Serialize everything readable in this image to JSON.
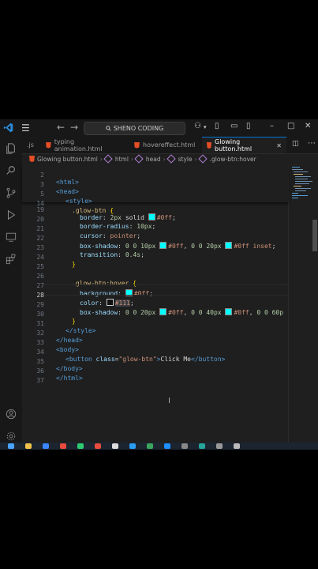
{
  "titlebar": {
    "search_text": "SHENO CODING",
    "menu_icon": "hamburger-icon",
    "back_icon": "arrow-left-icon",
    "forward_icon": "arrow-right-icon"
  },
  "tabs": [
    {
      "label": ".js",
      "type": "js"
    },
    {
      "label": "typing animation.html",
      "type": "html"
    },
    {
      "label": "hovereffect.html",
      "type": "html"
    },
    {
      "label": "Glowing button.html",
      "type": "html",
      "active": true
    }
  ],
  "breadcrumb": [
    "Glowing button.html",
    "html",
    "head",
    "style",
    ".glow-btn:hover"
  ],
  "colors": {
    "accent": "#0078d4",
    "swatch_cyan": "#00ffff",
    "swatch_dark": "#111111"
  },
  "sticky": [
    {
      "n": "2",
      "text": "<html>"
    },
    {
      "n": "3",
      "text": "<head>"
    },
    {
      "n": "5",
      "text": "<style>"
    },
    {
      "n": "14",
      "text": ".glow-btn {"
    }
  ],
  "lines": [
    {
      "n": "19",
      "text": "border: 2px solid #0ff;"
    },
    {
      "n": "20",
      "text": "border-radius: 10px;"
    },
    {
      "n": "21",
      "text": "cursor: pointer;"
    },
    {
      "n": "22",
      "text": "box-shadow: 0 0 10px #0ff, 0 0 20px #0ff inset;"
    },
    {
      "n": "23",
      "text": "transition: 0.4s;"
    },
    {
      "n": "24",
      "text": "}"
    },
    {
      "n": "25",
      "text": ""
    },
    {
      "n": "26",
      "text": ".glow-btn:hover {"
    },
    {
      "n": "27",
      "text": "background: #0ff;"
    },
    {
      "n": "28",
      "text": "color: #111;"
    },
    {
      "n": "29",
      "text": "box-shadow: 0 0 20px #0ff, 0 0 40px #0ff, 0 0 60p"
    },
    {
      "n": "30",
      "text": "}"
    },
    {
      "n": "31",
      "text": "</style>"
    },
    {
      "n": "32",
      "text": "</head>"
    },
    {
      "n": "33",
      "text": "<body>"
    },
    {
      "n": "34",
      "text": "<button class=\"glow-btn\">Click Me</button>"
    },
    {
      "n": "35",
      "text": "</body>"
    },
    {
      "n": "36",
      "text": "</html>"
    },
    {
      "n": "37",
      "text": ""
    }
  ],
  "current_line": "28"
}
